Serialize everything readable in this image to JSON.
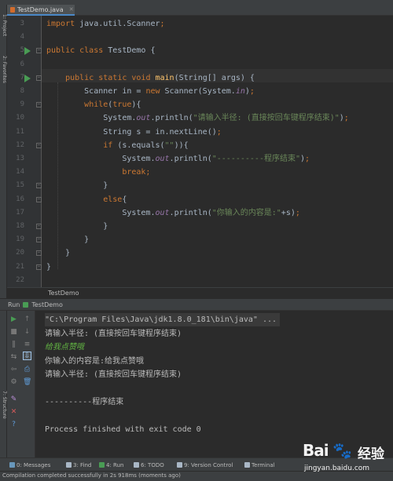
{
  "editor": {
    "tab_label": "TestDemo.java",
    "breadcrumb": "TestDemo",
    "lines": [
      {
        "n": "3",
        "tokens": [
          [
            "kw",
            "import"
          ],
          [
            "plain",
            " java.util.Scanner"
          ],
          [
            "kw",
            ";"
          ]
        ]
      },
      {
        "n": "4",
        "tokens": []
      },
      {
        "n": "5",
        "tokens": [
          [
            "kw",
            "public class"
          ],
          [
            "plain",
            " TestDemo {"
          ]
        ],
        "run": true
      },
      {
        "n": "6",
        "tokens": []
      },
      {
        "n": "7",
        "tokens": [
          [
            "plain",
            "    "
          ],
          [
            "kw",
            "public static void"
          ],
          [
            "plain",
            " "
          ],
          [
            "fn",
            "main"
          ],
          [
            "plain",
            "(String[] args) {"
          ]
        ],
        "run": true
      },
      {
        "n": "8",
        "tokens": [
          [
            "plain",
            "        Scanner in = "
          ],
          [
            "kw",
            "new"
          ],
          [
            "plain",
            " Scanner(System."
          ],
          [
            "fld",
            "in"
          ],
          [
            "plain",
            ")"
          ],
          [
            "kw",
            ";"
          ]
        ]
      },
      {
        "n": "9",
        "tokens": [
          [
            "plain",
            "        "
          ],
          [
            "kw",
            "while"
          ],
          [
            "plain",
            "("
          ],
          [
            "kw",
            "true"
          ],
          [
            "plain",
            "){"
          ]
        ]
      },
      {
        "n": "10",
        "tokens": [
          [
            "plain",
            "            System."
          ],
          [
            "fld",
            "out"
          ],
          [
            "plain",
            ".println("
          ],
          [
            "str",
            "\"请输入半径: (直接按回车键程序结束)\""
          ],
          [
            "plain",
            ")"
          ],
          [
            "kw",
            ";"
          ]
        ]
      },
      {
        "n": "11",
        "tokens": [
          [
            "plain",
            "            String s = in.nextLine()"
          ],
          [
            "kw",
            ";"
          ]
        ]
      },
      {
        "n": "12",
        "tokens": [
          [
            "plain",
            "            "
          ],
          [
            "kw",
            "if"
          ],
          [
            "plain",
            " (s.equals("
          ],
          [
            "str",
            "\"\""
          ],
          [
            "plain",
            ")){"
          ]
        ]
      },
      {
        "n": "13",
        "tokens": [
          [
            "plain",
            "                System."
          ],
          [
            "fld",
            "out"
          ],
          [
            "plain",
            ".println("
          ],
          [
            "str",
            "\"----------程序结束\""
          ],
          [
            "plain",
            ")"
          ],
          [
            "kw",
            ";"
          ]
        ]
      },
      {
        "n": "14",
        "tokens": [
          [
            "plain",
            "                "
          ],
          [
            "kw",
            "break;"
          ]
        ]
      },
      {
        "n": "15",
        "tokens": [
          [
            "plain",
            "            }"
          ]
        ]
      },
      {
        "n": "16",
        "tokens": [
          [
            "plain",
            "            "
          ],
          [
            "kw",
            "else"
          ],
          [
            "plain",
            "{"
          ]
        ]
      },
      {
        "n": "17",
        "tokens": [
          [
            "plain",
            "                System."
          ],
          [
            "fld",
            "out"
          ],
          [
            "plain",
            ".println("
          ],
          [
            "str",
            "\"你输入的内容是:\""
          ],
          [
            "plain",
            "+s)"
          ],
          [
            "kw",
            ";"
          ]
        ]
      },
      {
        "n": "18",
        "tokens": [
          [
            "plain",
            "            }"
          ]
        ]
      },
      {
        "n": "19",
        "tokens": [
          [
            "plain",
            "        }"
          ]
        ]
      },
      {
        "n": "20",
        "tokens": [
          [
            "plain",
            "    }"
          ]
        ]
      },
      {
        "n": "21",
        "tokens": [
          [
            "plain",
            "}"
          ]
        ]
      },
      {
        "n": "22",
        "tokens": []
      }
    ]
  },
  "run_panel": {
    "label": "Run",
    "config": "TestDemo",
    "console": [
      {
        "kind": "cmd",
        "text": "\"C:\\Program Files\\Java\\jdk1.8.0_181\\bin\\java\" ..."
      },
      {
        "kind": "out",
        "text": "请输入半径: (直接按回车键程序结束)"
      },
      {
        "kind": "input",
        "text": "给我点赞哦"
      },
      {
        "kind": "out",
        "text": "你输入的内容是:给我点赞哦"
      },
      {
        "kind": "out",
        "text": "请输入半径: (直接按回车键程序结束)"
      },
      {
        "kind": "blank",
        "text": ""
      },
      {
        "kind": "out",
        "text": "----------程序结束"
      },
      {
        "kind": "blank",
        "text": ""
      },
      {
        "kind": "out",
        "text": "Process finished with exit code 0"
      }
    ]
  },
  "tool_windows": [
    {
      "label": "0: Messages",
      "color": "#6897bb"
    },
    {
      "label": "3: Find",
      "color": "#a9b7c6"
    },
    {
      "label": "4: Run",
      "color": "#499c54"
    },
    {
      "label": "6: TODO",
      "color": "#a9b7c6"
    },
    {
      "label": "9: Version Control",
      "color": "#a9b7c6"
    },
    {
      "label": "Terminal",
      "color": "#a9b7c6"
    }
  ],
  "status": {
    "text": "Compilation completed successfully in 2s 918ms (moments ago)"
  },
  "watermark": {
    "logo": "Bai",
    "logo_cn": "经验",
    "url": "jingyan.baidu.com"
  },
  "left_tabs": [
    "1: Project",
    "2: Favorites",
    "7: Structure"
  ]
}
